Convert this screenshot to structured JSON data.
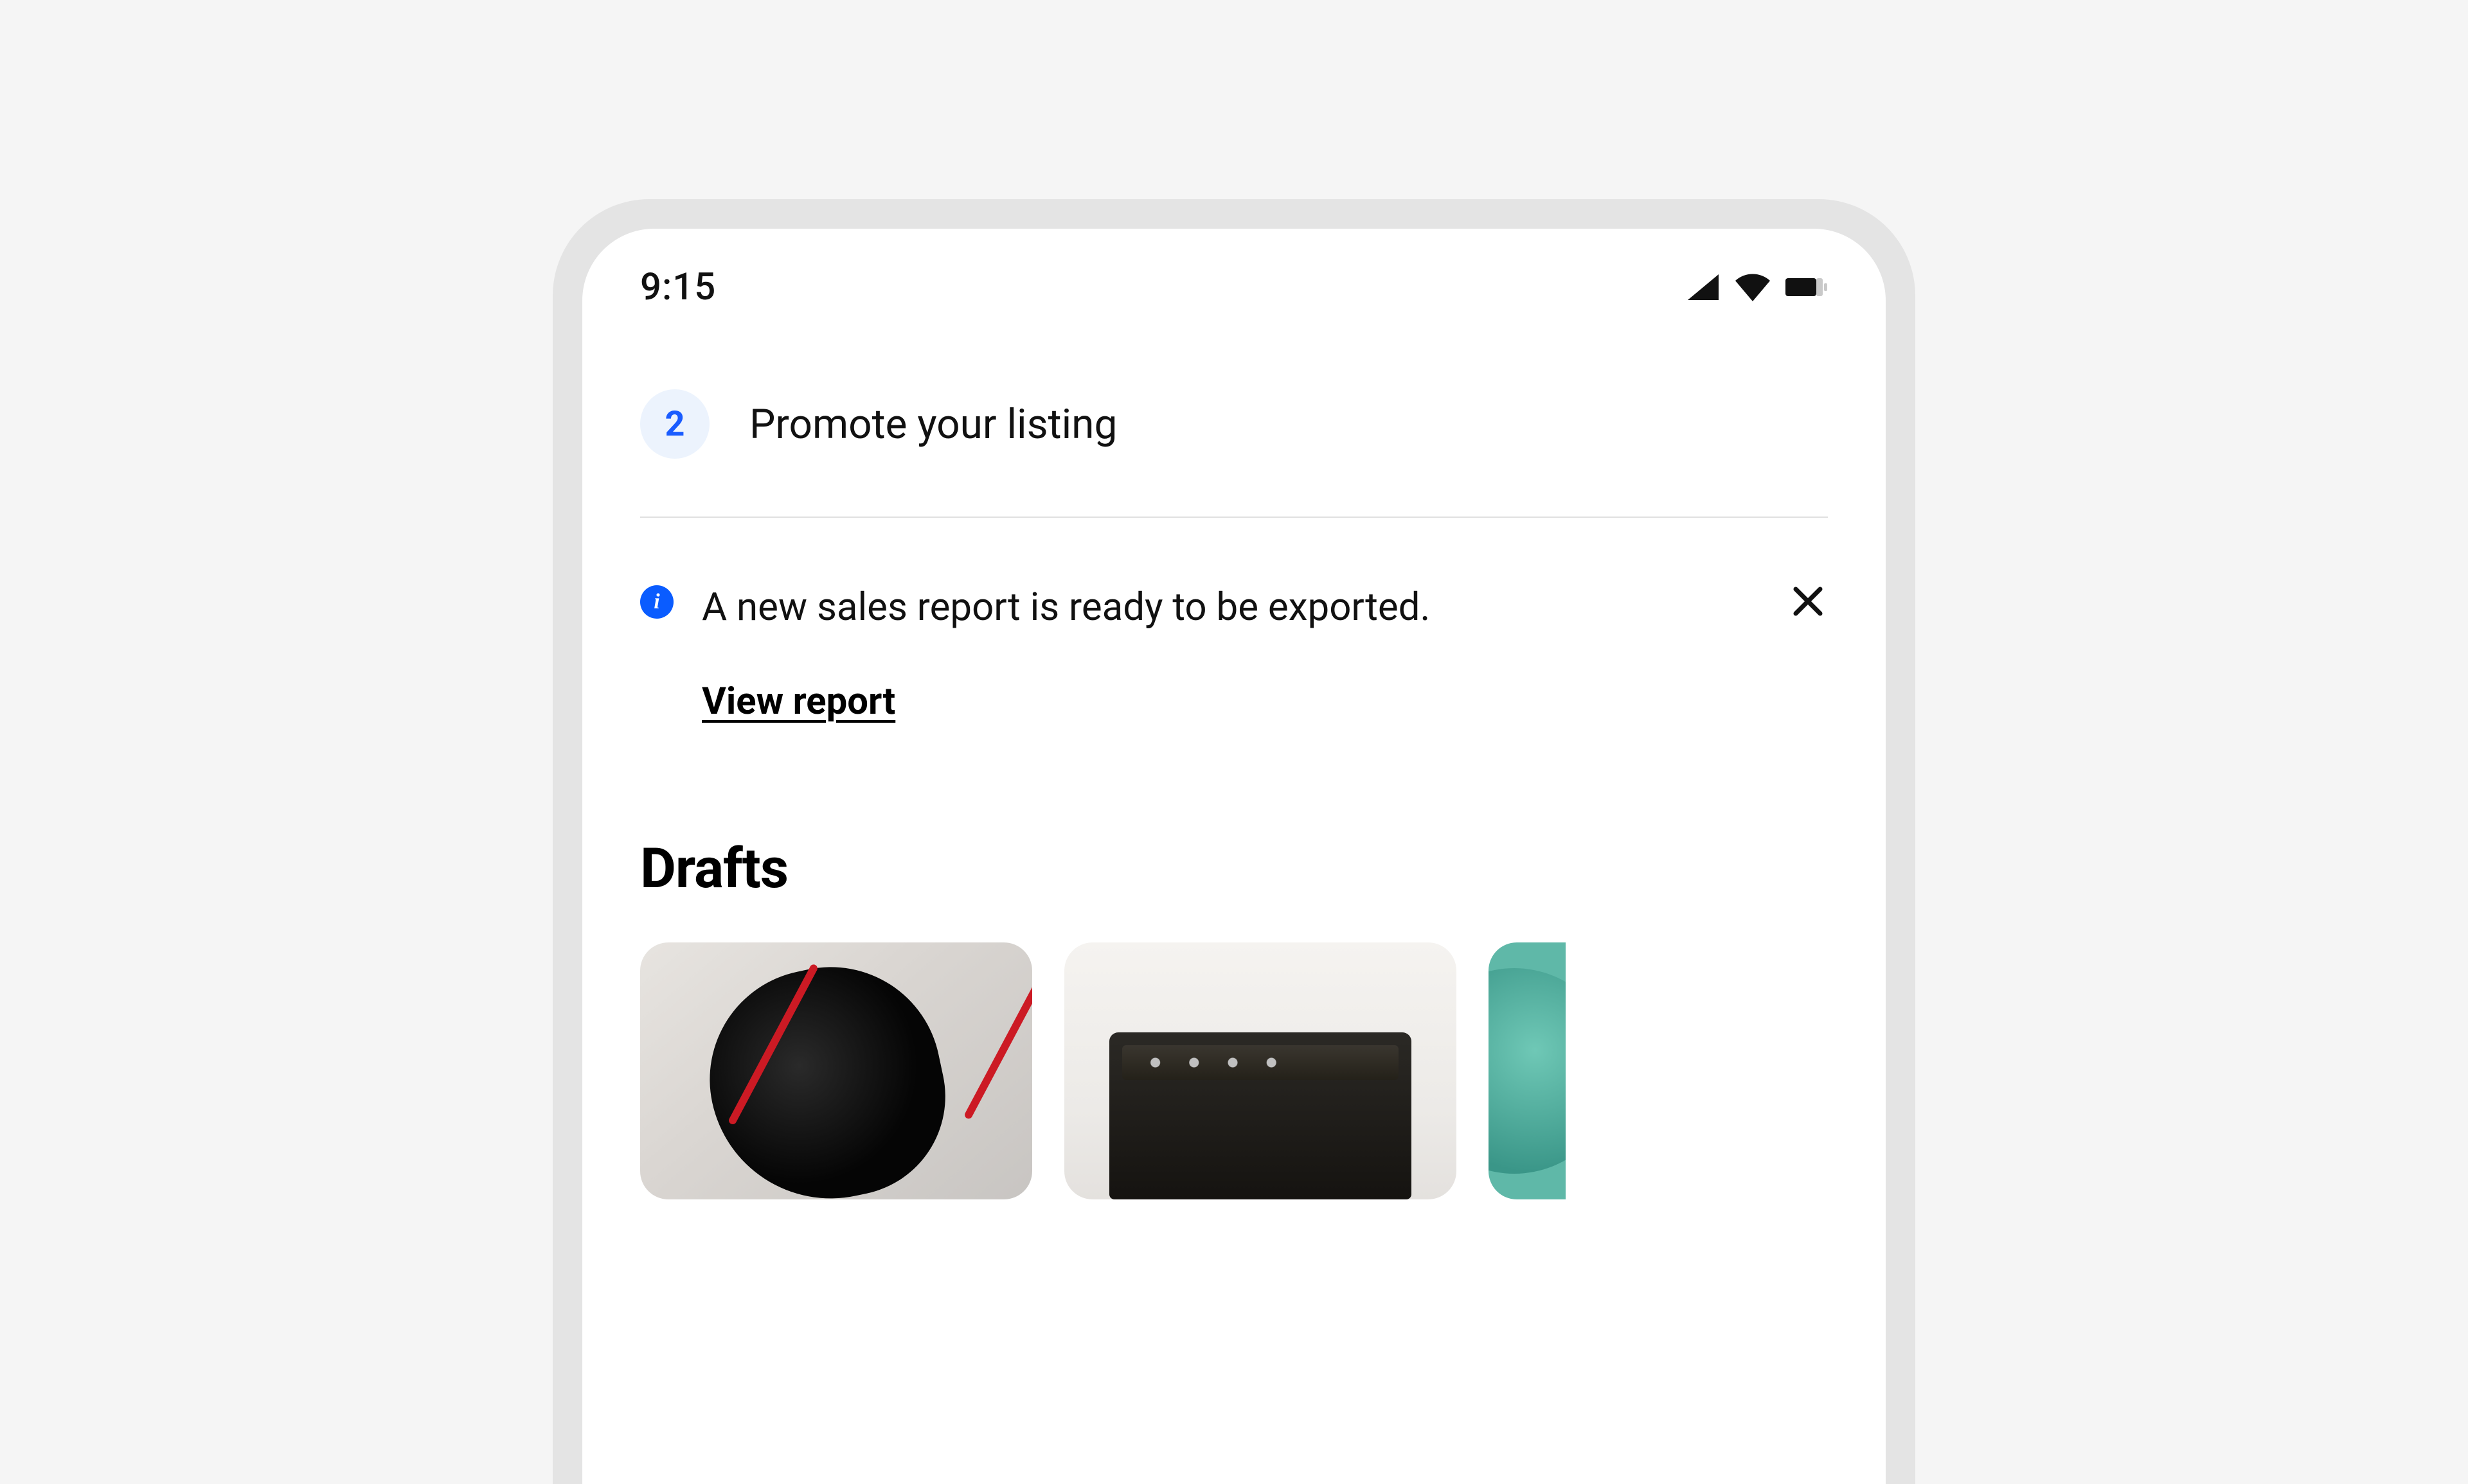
{
  "status_bar": {
    "time": "9:15"
  },
  "step": {
    "number": "2",
    "label": "Promote your listing"
  },
  "alert": {
    "icon_glyph": "i",
    "message": "A new sales report is ready to be exported.",
    "action_label": "View report"
  },
  "drafts": {
    "title": "Drafts"
  },
  "colors": {
    "accent_blue": "#1a5cff",
    "badge_bg": "#ecf3fd",
    "info_icon_bg": "#0a5cff"
  }
}
